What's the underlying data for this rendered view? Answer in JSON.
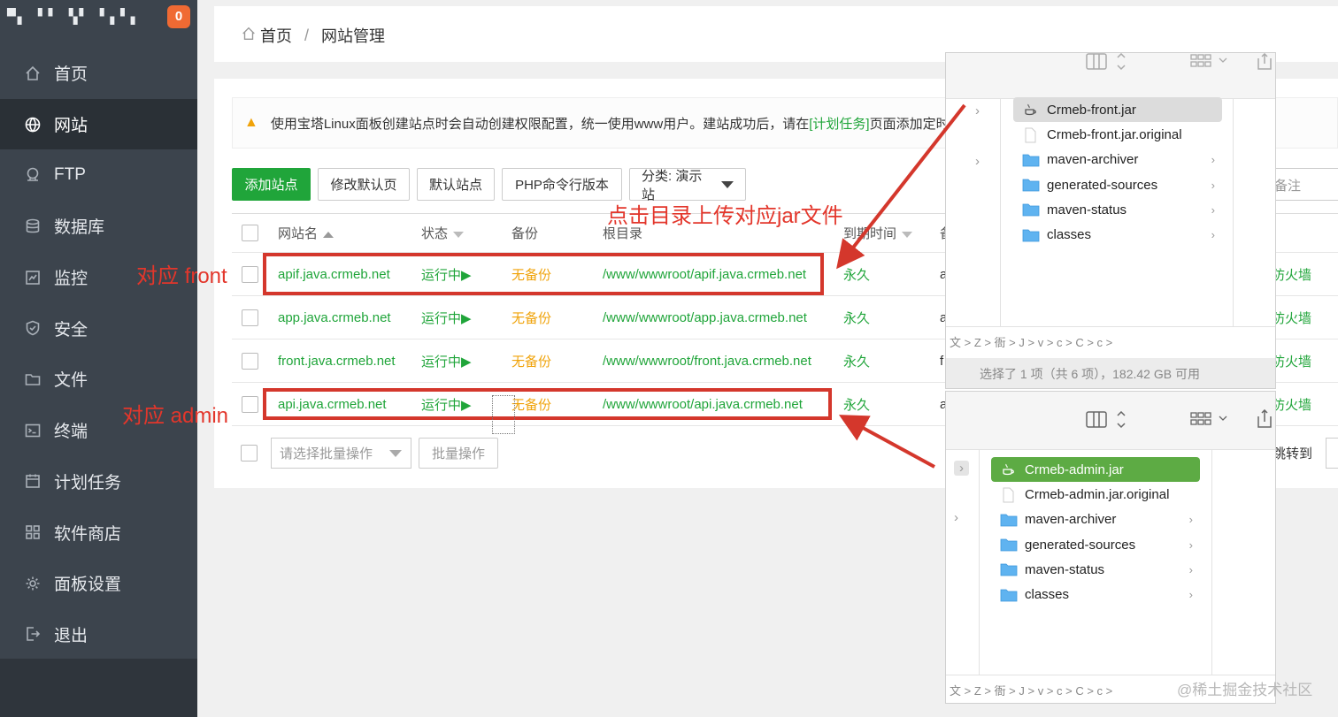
{
  "sidebar": {
    "top_text": "▀▖ ▘▘ ▚▘ ▘▖▘▖",
    "badge": "0",
    "items": [
      {
        "label": "首页",
        "icon": "home-icon"
      },
      {
        "label": "网站",
        "icon": "globe-icon"
      },
      {
        "label": "FTP",
        "icon": "ftp-icon"
      },
      {
        "label": "数据库",
        "icon": "database-icon"
      },
      {
        "label": "监控",
        "icon": "monitor-icon"
      },
      {
        "label": "安全",
        "icon": "shield-icon"
      },
      {
        "label": "文件",
        "icon": "folder-icon"
      },
      {
        "label": "终端",
        "icon": "terminal-icon"
      },
      {
        "label": "计划任务",
        "icon": "calendar-icon"
      },
      {
        "label": "软件商店",
        "icon": "apps-icon"
      },
      {
        "label": "面板设置",
        "icon": "gear-icon"
      },
      {
        "label": "退出",
        "icon": "logout-icon"
      }
    ]
  },
  "breadcrumb": {
    "home": "首页",
    "sep": "/",
    "current": "网站管理"
  },
  "notice": {
    "text_before": "使用宝塔Linux面板创建站点时会自动创建权限配置，统一使用www用户。建站成功后，请在",
    "link": "[计划任务]",
    "text_after": "页面添加定时任务"
  },
  "toolbar": {
    "add_site": "添加站点",
    "edit_default": "修改默认页",
    "default_site": "默认站点",
    "php_cli": "PHP命令行版本",
    "category": "分类: 演示站",
    "note_placeholder": "备注"
  },
  "table": {
    "headers": {
      "name": "网站名",
      "status": "状态",
      "backup": "备份",
      "root": "根目录",
      "expire": "到期时间",
      "note": "备"
    },
    "rows": [
      {
        "name": "apif.java.crmeb.net",
        "status": "运行中▶",
        "backup": "无备份",
        "root": "/www/wwwroot/apif.java.crmeb.net",
        "expire": "永久",
        "note": "a",
        "fw": "防火墙"
      },
      {
        "name": "app.java.crmeb.net",
        "status": "运行中▶",
        "backup": "无备份",
        "root": "/www/wwwroot/app.java.crmeb.net",
        "expire": "永久",
        "note": "a",
        "fw": "防火墙"
      },
      {
        "name": "front.java.crmeb.net",
        "status": "运行中▶",
        "backup": "无备份",
        "root": "/www/wwwroot/front.java.crmeb.net",
        "expire": "永久",
        "note": "f",
        "fw": "防火墙"
      },
      {
        "name": "api.java.crmeb.net",
        "status": "运行中▶",
        "backup": "无备份",
        "root": "/www/wwwroot/api.java.crmeb.net",
        "expire": "永久",
        "note": "a",
        "fw": "防火墙"
      }
    ]
  },
  "bottom": {
    "batch_select": "请选择批量操作",
    "batch_button": "批量操作",
    "jump": "跳转到"
  },
  "annotations": {
    "upload": "点击目录上传对应jar文件",
    "front": "对应 front",
    "admin": "对应 admin"
  },
  "finder_front": {
    "files": [
      {
        "name": "Crmeb-front.jar",
        "type": "jar",
        "selected": true
      },
      {
        "name": "Crmeb-front.jar.original",
        "type": "file"
      },
      {
        "name": "maven-archiver",
        "type": "folder"
      },
      {
        "name": "generated-sources",
        "type": "folder"
      },
      {
        "name": "maven-status",
        "type": "folder"
      },
      {
        "name": "classes",
        "type": "folder"
      }
    ],
    "path": "文 > Z > 衙 > J > v > c > C > c >",
    "status": "选择了 1 项（共 6 项），182.42 GB 可用"
  },
  "finder_admin": {
    "files": [
      {
        "name": "Crmeb-admin.jar",
        "type": "jar",
        "selected": true
      },
      {
        "name": "Crmeb-admin.jar.original",
        "type": "file"
      },
      {
        "name": "maven-archiver",
        "type": "folder"
      },
      {
        "name": "generated-sources",
        "type": "folder"
      },
      {
        "name": "maven-status",
        "type": "folder"
      },
      {
        "name": "classes",
        "type": "folder"
      }
    ],
    "path": "文 > Z > 衙 > J > v > c > C > c >"
  },
  "watermark": "@稀土掘金技术社区",
  "colors": {
    "accent_green": "#20a53a",
    "warning_orange": "#f0a30a",
    "annotation_red": "#d4372c",
    "sidebar": "#3c444d"
  }
}
